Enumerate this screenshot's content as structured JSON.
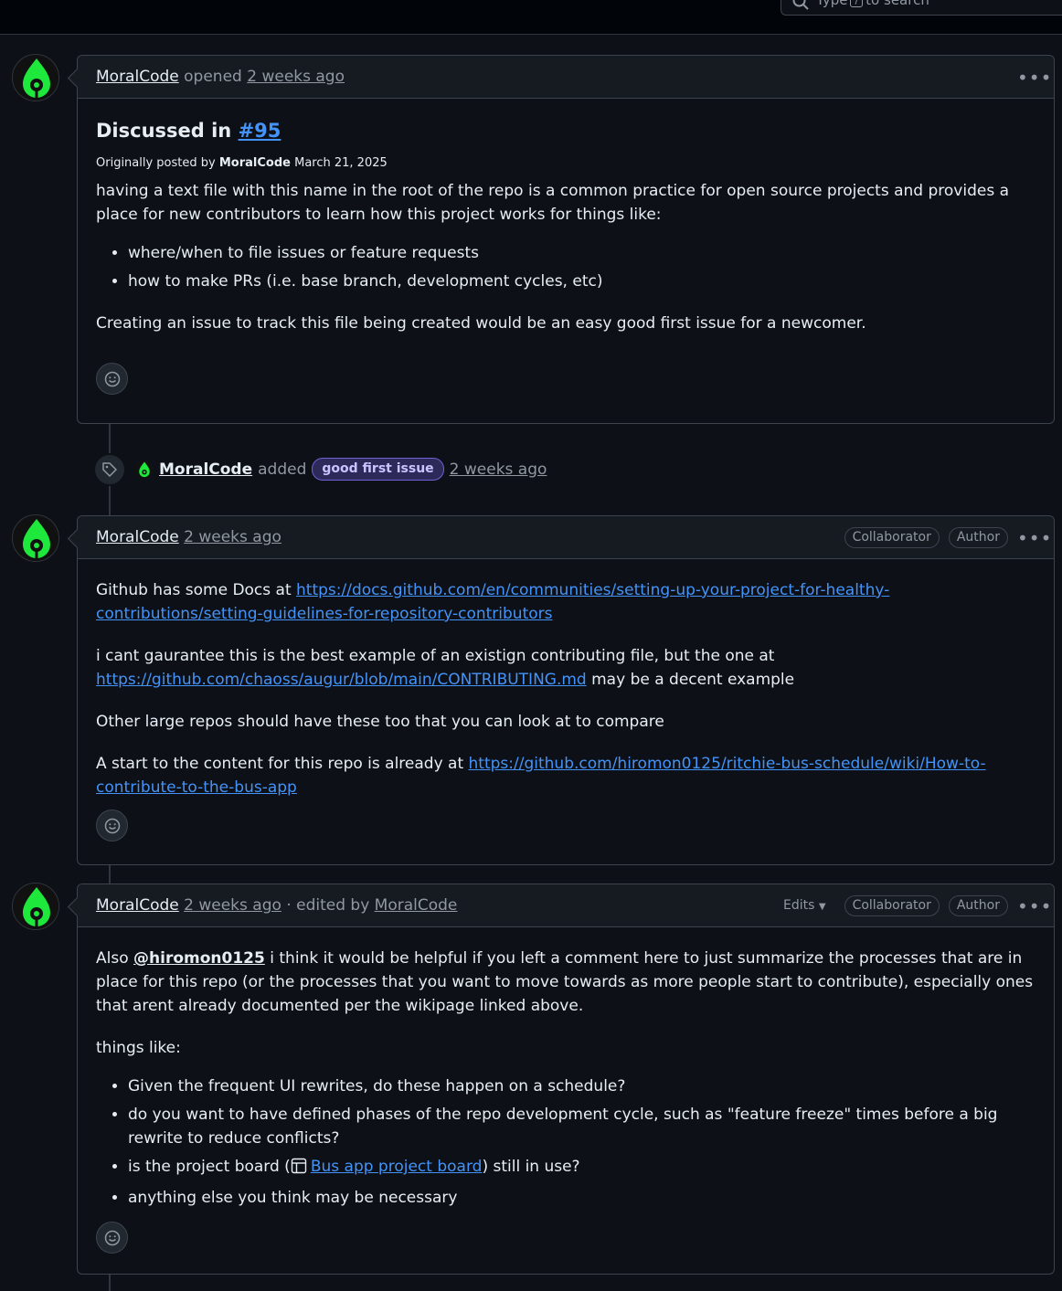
{
  "search": {
    "before": "Type",
    "key": "/",
    "after": "to search"
  },
  "comments": [
    {
      "author": "MoralCode",
      "verb": "opened",
      "time": "2 weeks ago",
      "heading_prefix": "Discussed in",
      "heading_link": "#95",
      "orig_prefix": "Originally posted by",
      "orig_author": "MoralCode",
      "orig_date": "March 21, 2025",
      "p1": "having a text file with this name in the root of the repo is a common practice for open source projects and provides a place for new contributors to learn how this project works for things like:",
      "items": [
        "where/when to file issues or feature requests",
        "how to make PRs (i.e. base branch, development cycles, etc)"
      ],
      "p2": "Creating an issue to track this file being created would be an easy good first issue for a newcomer."
    },
    {
      "author": "MoralCode",
      "time": "2 weeks ago",
      "badge1": "Collaborator",
      "badge2": "Author",
      "p1_text": "Github has some Docs at",
      "p1_link": "https://docs.github.com/en/communities/setting-up-your-project-for-healthy-contributions/setting-guidelines-for-repository-contributors",
      "p2_text": "i cant gaurantee this is the best example of an existign contributing file, but the one at",
      "p2_link": "https://github.com/chaoss/augur/blob/main/CONTRIBUTING.md",
      "p2_after": "may be a decent example",
      "p3": "Other large repos should have these too that you can look at to compare",
      "p4_text": "A start to the content for this repo is already at",
      "p4_link": "https://github.com/hiromon0125/ritchie-bus-schedule/wiki/How-to-contribute-to-the-bus-app"
    },
    {
      "author": "MoralCode",
      "time": "2 weeks ago",
      "edited_prefix": "· edited by",
      "edited_by": "MoralCode",
      "edits": "Edits",
      "badge1": "Collaborator",
      "badge2": "Author",
      "p1_before": "Also",
      "p1_mention": "@hiromon0125",
      "p1_after": "i think it would be helpful if you left a comment here to just summarize the processes that are in place for this repo (or the processes that you want to move towards as more people start to contribute), especially ones that arent already documented per the wikipage linked above.",
      "p2": "things like:",
      "item1": "Given the frequent UI rewrites, do these happen on a schedule?",
      "item2": "do you want to have defined phases of the repo development cycle, such as \"feature freeze\" times before a big rewrite to reduce conflicts?",
      "item3_before": "is the project board (",
      "item3_link": "Bus app project board",
      "item3_after": ") still in use?",
      "item4": "anything else you think may be necessary"
    }
  ],
  "event": {
    "author": "MoralCode",
    "action": "added",
    "label": "good first issue",
    "time": "2 weeks ago"
  },
  "colors": {
    "bg": "#0d1117",
    "header_bg": "#161b22",
    "link": "#4493f8",
    "avatar_green": "#1ee83c",
    "label_bg": "#2d2a5a"
  }
}
